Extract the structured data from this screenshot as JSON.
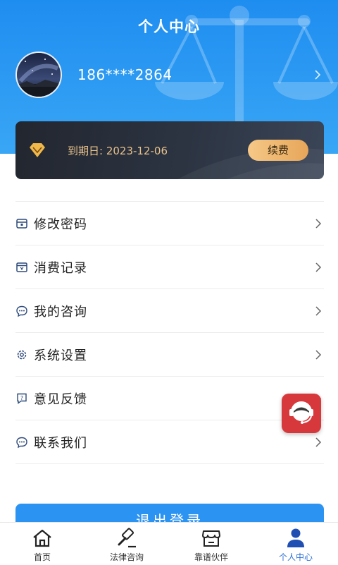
{
  "header": {
    "title": "个人中心",
    "colors": {
      "top": "#1e8df0",
      "bottom": "#39a6f5"
    }
  },
  "profile": {
    "phone": "186****2864",
    "avatar_icon": "night-sky-avatar"
  },
  "vip": {
    "expire_text": "到期日: 2023-12-06",
    "renew_label": "续费",
    "icon": "diamond-icon",
    "accent": "#e9c28a"
  },
  "menu": {
    "items": [
      {
        "label": "修改密码",
        "icon": "lock-icon"
      },
      {
        "label": "消费记录",
        "icon": "receipt-icon"
      },
      {
        "label": "我的咨询",
        "icon": "chat-icon"
      },
      {
        "label": "系统设置",
        "icon": "gear-icon"
      },
      {
        "label": "意见反馈",
        "icon": "feedback-icon"
      },
      {
        "label": "联系我们",
        "icon": "contact-icon"
      }
    ]
  },
  "logout": {
    "label": "退出登录"
  },
  "tabbar": {
    "tabs": [
      {
        "label": "首页",
        "icon": "home-icon",
        "active": false
      },
      {
        "label": "法律咨询",
        "icon": "gavel-icon",
        "active": false
      },
      {
        "label": "靠谱伙伴",
        "icon": "store-icon",
        "active": false
      },
      {
        "label": "个人中心",
        "icon": "user-icon",
        "active": true
      }
    ],
    "active_color": "#2b6fd6"
  },
  "support_fab": {
    "icon": "customer-service-icon",
    "color": "#d7383b"
  }
}
